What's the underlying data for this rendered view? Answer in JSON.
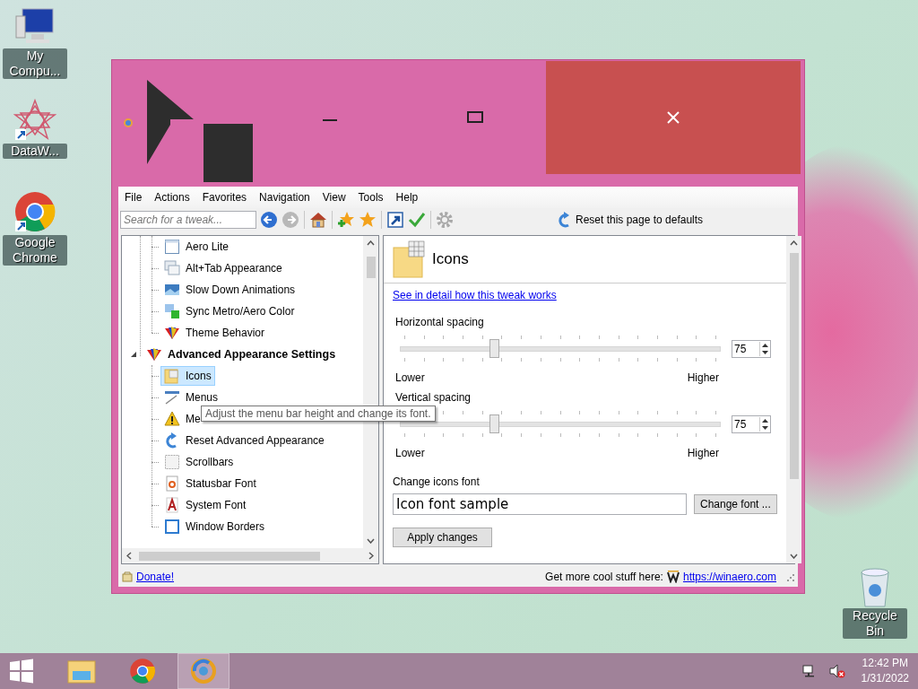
{
  "desktop_icons": [
    {
      "label": "My Compu...",
      "kind": "computer"
    },
    {
      "label": "DataW...",
      "kind": "star-shortcut"
    },
    {
      "label": "Google Chrome",
      "kind": "chrome-shortcut"
    }
  ],
  "recycle_bin": {
    "label": "Recycle Bin"
  },
  "window": {
    "menu": [
      "File",
      "Actions",
      "Favorites",
      "Navigation",
      "View",
      "Tools",
      "Help"
    ],
    "toolbar": {
      "search_placeholder": "Search for a tweak...",
      "buttons": [
        {
          "kind": "back",
          "disabled": false
        },
        {
          "kind": "forward",
          "disabled": true
        },
        {
          "kind": "home"
        },
        {
          "kind": "add-favorite"
        },
        {
          "kind": "favorites"
        },
        {
          "kind": "shortcut"
        },
        {
          "kind": "apply"
        },
        {
          "kind": "settings",
          "disabled": true
        }
      ],
      "reset_label": "Reset this page to defaults"
    },
    "tree": {
      "continued_items": [
        {
          "label": "Aero Lite",
          "kind": "window",
          "selected": false
        },
        {
          "label": "Alt+Tab Appearance",
          "kind": "screens",
          "selected": false
        },
        {
          "label": "Slow Down Animations",
          "kind": "photo",
          "selected": false
        },
        {
          "label": "Sync Metro/Aero Color",
          "kind": "sync",
          "selected": false
        },
        {
          "label": "Theme Behavior",
          "kind": "palette",
          "selected": false
        }
      ],
      "groups": [
        {
          "label": "Advanced Appearance Settings",
          "expanded": true,
          "children": [
            {
              "label": "Icons",
              "kind": "folder",
              "selected": true
            },
            {
              "label": "Menus",
              "kind": "menu",
              "selected": false
            },
            {
              "label": "Me",
              "kind": "warning",
              "selected": false
            },
            {
              "label": "Reset Advanced Appearance",
              "kind": "reset",
              "selected": false
            },
            {
              "label": "Scrollbars",
              "kind": "scrollbar",
              "selected": false
            },
            {
              "label": "Statusbar Font",
              "kind": "page",
              "selected": false
            },
            {
              "label": "System Font",
              "kind": "letter",
              "selected": false
            },
            {
              "label": "Window Borders",
              "kind": "border",
              "selected": false
            }
          ]
        }
      ]
    },
    "tooltip": "Adjust the menu bar height and change its font.",
    "page": {
      "title": "Icons",
      "link": "See in detail how this tweak works",
      "sliders": [
        {
          "label": "Horizontal spacing",
          "level": 0.29,
          "value": "75",
          "low": "Lower",
          "high": "Higher"
        },
        {
          "label": "Vertical spacing",
          "level": 0.29,
          "value": "75",
          "low": "Lower",
          "high": "Higher"
        }
      ],
      "font_label": "Change icons font",
      "font_sample": "Icon font sample",
      "change_font_button": "Change font ...",
      "apply_button": "Apply changes"
    },
    "status_bar": {
      "donate": "Donate!",
      "promo": "Get more cool stuff here:",
      "url": "https://winaero.com"
    }
  },
  "taskbar": {
    "apps": [
      {
        "kind": "explorer",
        "selected": false
      },
      {
        "kind": "chrome",
        "selected": false
      },
      {
        "kind": "winaero",
        "selected": true
      }
    ],
    "time": "12:42 PM",
    "date": "1/31/2022"
  }
}
